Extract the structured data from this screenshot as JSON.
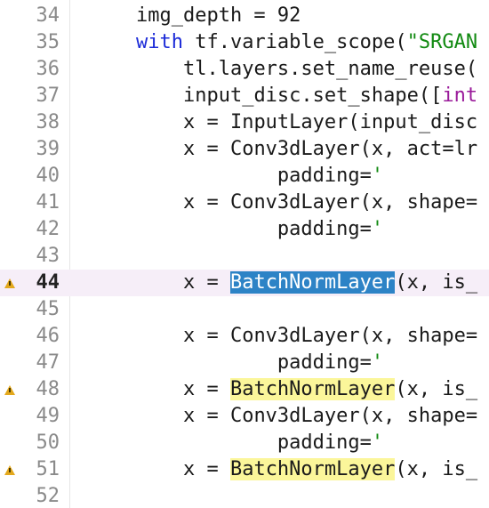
{
  "editor": {
    "lines": [
      {
        "num": "34",
        "indent": "    ",
        "segs": [
          {
            "t": "img_depth = 92"
          }
        ]
      },
      {
        "num": "35",
        "indent": "    ",
        "segs": [
          {
            "t": "with",
            "c": "kw"
          },
          {
            "t": " tf.variable_scope("
          },
          {
            "t": "\"SRGAN",
            "c": "str"
          }
        ]
      },
      {
        "num": "36",
        "indent": "        ",
        "segs": [
          {
            "t": "tl.layers.set_name_reuse("
          }
        ]
      },
      {
        "num": "37",
        "indent": "        ",
        "segs": [
          {
            "t": "input_disc.set_shape(["
          },
          {
            "t": "int",
            "c": "mag"
          }
        ]
      },
      {
        "num": "38",
        "indent": "        ",
        "segs": [
          {
            "t": "x = InputLayer(input_disc"
          }
        ]
      },
      {
        "num": "39",
        "indent": "        ",
        "segs": [
          {
            "t": "x = Conv3dLayer(x, act=lr"
          }
        ]
      },
      {
        "num": "40",
        "indent": "                ",
        "segs": [
          {
            "t": "padding="
          },
          {
            "t": "'",
            "c": "str"
          }
        ]
      },
      {
        "num": "41",
        "indent": "        ",
        "segs": [
          {
            "t": "x = Conv3dLayer(x, shape="
          }
        ]
      },
      {
        "num": "42",
        "indent": "                ",
        "segs": [
          {
            "t": "padding="
          },
          {
            "t": "'",
            "c": "str"
          }
        ]
      },
      {
        "num": "43",
        "indent": "",
        "segs": []
      },
      {
        "num": "44",
        "indent": "        ",
        "current": true,
        "warning": true,
        "segs": [
          {
            "t": "x = "
          },
          {
            "t": "BatchNormLayer",
            "c": "sel"
          },
          {
            "t": "(x, is_"
          }
        ]
      },
      {
        "num": "45",
        "indent": "",
        "segs": []
      },
      {
        "num": "46",
        "indent": "        ",
        "segs": [
          {
            "t": "x = Conv3dLayer(x, shape="
          }
        ]
      },
      {
        "num": "47",
        "indent": "                ",
        "segs": [
          {
            "t": "padding="
          },
          {
            "t": "'",
            "c": "str"
          }
        ]
      },
      {
        "num": "48",
        "indent": "        ",
        "warning": true,
        "segs": [
          {
            "t": "x = "
          },
          {
            "t": "BatchNormLayer",
            "c": "hl"
          },
          {
            "t": "(x, is_"
          }
        ]
      },
      {
        "num": "49",
        "indent": "        ",
        "segs": [
          {
            "t": "x = Conv3dLayer(x, shape="
          }
        ]
      },
      {
        "num": "50",
        "indent": "                ",
        "segs": [
          {
            "t": "padding="
          },
          {
            "t": "'",
            "c": "str"
          }
        ]
      },
      {
        "num": "51",
        "indent": "        ",
        "warning": true,
        "segs": [
          {
            "t": "x = "
          },
          {
            "t": "BatchNormLayer",
            "c": "hl"
          },
          {
            "t": "(x, is_"
          }
        ]
      },
      {
        "num": "52",
        "indent": "",
        "segs": []
      }
    ]
  }
}
